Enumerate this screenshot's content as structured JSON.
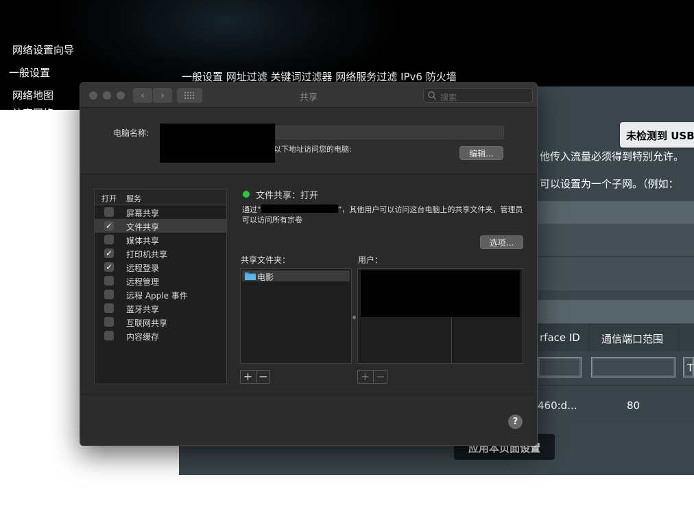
{
  "background": {
    "nav_items": [
      "网络设置向导",
      "一般设置",
      "网络地图",
      "访客网络"
    ],
    "tabs_text": "一般设置 网址过滤 关键词过滤器 网络服务过滤 IPv6 防火墙",
    "usb_badge": "未检测到 USB",
    "text_line1": "他传入流量必须得到特别允许。",
    "text_line2": "可以设置为一个子网。（例如：",
    "table_headers": [
      "rface ID",
      "通信端口范围"
    ],
    "table_header_partial": "T",
    "table_values": [
      "460:d...",
      "80"
    ],
    "apply_button": "应用本页面设置"
  },
  "window": {
    "title": "共享",
    "search_placeholder": "搜索",
    "nav_back": "‹",
    "nav_forward": "›",
    "computer_name_label": "电脑名称:",
    "address_hint": "以下地址访问您的电脑:",
    "edit_button": "编辑...",
    "service_table": {
      "header_on": "打开",
      "header_service": "服务",
      "items": [
        {
          "label": "屏幕共享",
          "checked": false,
          "selected": false
        },
        {
          "label": "文件共享",
          "checked": true,
          "selected": true
        },
        {
          "label": "媒体共享",
          "checked": false,
          "selected": false
        },
        {
          "label": "打印机共享",
          "checked": true,
          "selected": false
        },
        {
          "label": "远程登录",
          "checked": true,
          "selected": false
        },
        {
          "label": "远程管理",
          "checked": false,
          "selected": false
        },
        {
          "label": "远程 Apple 事件",
          "checked": false,
          "selected": false
        },
        {
          "label": "蓝牙共享",
          "checked": false,
          "selected": false
        },
        {
          "label": "互联网共享",
          "checked": false,
          "selected": false
        },
        {
          "label": "内容缓存",
          "checked": false,
          "selected": false
        }
      ]
    },
    "status_text": "文件共享：打开",
    "desc_prefix": "通过“",
    "desc_suffix": "”，其他用户可以访问这台电脑上的共享文件夹，管理员可以访问所有宗卷",
    "options_button": "选项...",
    "shared_folders_label": "共享文件夹：",
    "users_label": "用户：",
    "shared_folders": [
      "电影"
    ],
    "plus": "+",
    "minus": "−",
    "help": "?"
  },
  "colors": {
    "status_green": "#2ec73d",
    "folder_blue": "#4aa3df",
    "window_bg": "#2a2a2a"
  }
}
